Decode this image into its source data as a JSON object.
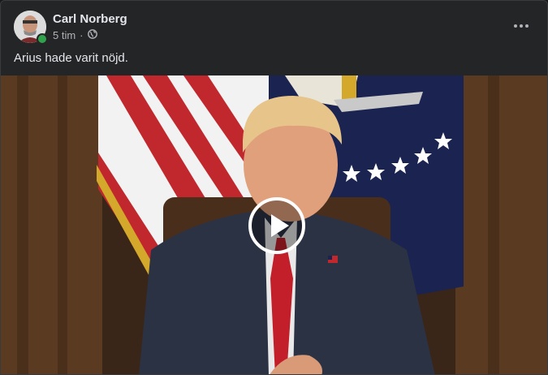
{
  "post": {
    "author": "Carl Norberg",
    "time": "5 tim",
    "separator": "·",
    "text": "Arius hade varit nöjd."
  },
  "icons": {
    "globe": "globe-icon",
    "more": "more-options-icon",
    "play": "play-icon",
    "online": "online-status-dot"
  },
  "colors": {
    "background": "#242526",
    "text_primary": "#e4e6eb",
    "text_secondary": "#b0b3b8",
    "online": "#31a24c"
  }
}
